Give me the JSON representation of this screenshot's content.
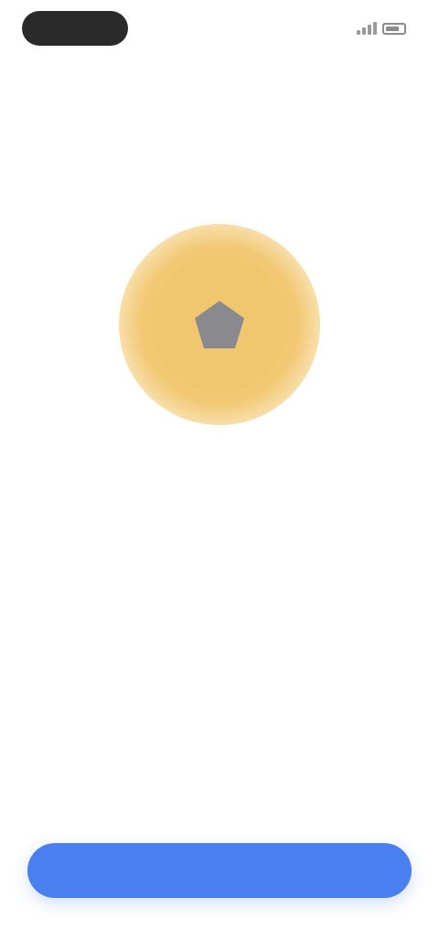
{
  "status_bar": {
    "pill_text": "",
    "signal_icon": "signal-bars-icon",
    "battery_icon": "battery-icon"
  },
  "hero": {
    "icon": "pentagon-badge-icon",
    "badge_color": "#f0c66f",
    "icon_color": "#8a8a8e"
  },
  "content": {
    "title": "",
    "description": ""
  },
  "actions": {
    "primary_label": "",
    "primary_color": "#4a7ff0"
  }
}
